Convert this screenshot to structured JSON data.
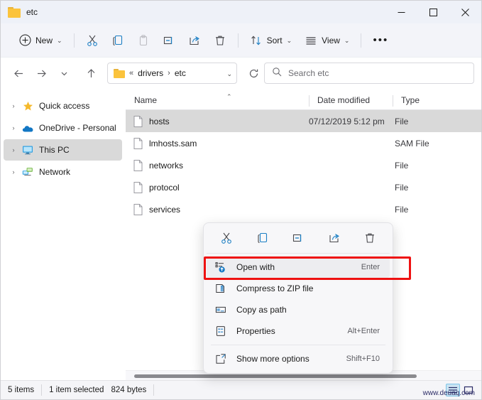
{
  "window": {
    "title": "etc",
    "folder_icon": "folder-icon",
    "controls": [
      {
        "name": "minimize",
        "glyph": "minimize-icon"
      },
      {
        "name": "maximize",
        "glyph": "maximize-icon"
      },
      {
        "name": "close",
        "glyph": "close-icon"
      }
    ]
  },
  "commandbar": {
    "new_label": "New",
    "sort_label": "Sort",
    "view_label": "View",
    "more_label": "•••",
    "items": [
      {
        "name": "new-button",
        "icon": "plus-circle-icon",
        "label": "New",
        "caret": "⌄"
      },
      {
        "name": "cut-button",
        "icon": "scissors-icon",
        "label": ""
      },
      {
        "name": "copy-button",
        "icon": "copy-icon",
        "label": ""
      },
      {
        "name": "paste-button",
        "icon": "clipboard-icon",
        "label": ""
      },
      {
        "name": "rename-button",
        "icon": "rename-icon",
        "label": ""
      },
      {
        "name": "share-button",
        "icon": "share-icon",
        "label": ""
      },
      {
        "name": "delete-button",
        "icon": "trash-icon",
        "label": ""
      },
      {
        "name": "sort-button",
        "icon": "sort-arrows-icon",
        "label": "Sort",
        "caret": "⌄"
      },
      {
        "name": "view-button",
        "icon": "hamburger-icon",
        "label": "View",
        "caret": "⌄"
      },
      {
        "name": "more-button",
        "icon": "ellipsis-icon",
        "label": ""
      }
    ]
  },
  "navbar": {
    "back": "back-arrow-icon",
    "forward": "forward-arrow-icon",
    "recent": "chevron-down-icon",
    "up": "up-arrow-icon",
    "breadcrumb": {
      "overflow": "«",
      "parts": [
        "drivers",
        "etc"
      ],
      "separator": "›",
      "dropdown": "⌄"
    },
    "refresh": "refresh-icon"
  },
  "search": {
    "icon": "search-icon",
    "placeholder": "Search etc"
  },
  "sidebar": {
    "items": [
      {
        "label": "Quick access",
        "icon": "star-icon",
        "selected": false
      },
      {
        "label": "OneDrive - Personal",
        "icon": "cloud-icon",
        "selected": false
      },
      {
        "label": "This PC",
        "icon": "monitor-icon",
        "selected": true
      },
      {
        "label": "Network",
        "icon": "network-icon",
        "selected": false
      }
    ],
    "expander": "›"
  },
  "filelist": {
    "columns": [
      {
        "key": "name",
        "label": "Name",
        "sorted": true,
        "sort_caret": "⌃"
      },
      {
        "key": "date",
        "label": "Date modified"
      },
      {
        "key": "type",
        "label": "Type"
      }
    ],
    "rows": [
      {
        "name": "hosts",
        "date": "07/12/2019 5:12 pm",
        "type": "File",
        "selected": true
      },
      {
        "name": "lmhosts.sam",
        "date": "",
        "type": "SAM File",
        "selected": false
      },
      {
        "name": "networks",
        "date": "",
        "type": "File",
        "selected": false
      },
      {
        "name": "protocol",
        "date": "",
        "type": "File",
        "selected": false
      },
      {
        "name": "services",
        "date": "",
        "type": "File",
        "selected": false
      }
    ]
  },
  "contextmenu": {
    "icon_row": [
      {
        "name": "cut",
        "icon": "scissors-icon"
      },
      {
        "name": "copy",
        "icon": "copy-icon"
      },
      {
        "name": "rename",
        "icon": "rename-icon"
      },
      {
        "name": "share",
        "icon": "share-icon"
      },
      {
        "name": "delete",
        "icon": "trash-icon"
      }
    ],
    "items": [
      {
        "label": "Open with",
        "accel": "Enter",
        "icon": "open-with-icon",
        "highlighted": true
      },
      {
        "label": "Compress to ZIP file",
        "accel": "",
        "icon": "zip-icon",
        "highlighted": false
      },
      {
        "label": "Copy as path",
        "accel": "",
        "icon": "copy-path-icon",
        "highlighted": false
      },
      {
        "label": "Properties",
        "accel": "Alt+Enter",
        "icon": "properties-icon",
        "highlighted": false
      },
      {
        "label": "Show more options",
        "accel": "Shift+F10",
        "icon": "more-options-icon",
        "highlighted": false
      }
    ]
  },
  "statusbar": {
    "item_count": "5 items",
    "selection": "1 item selected",
    "size": "824 bytes",
    "watermark": "www.deuaq.com",
    "view_buttons": [
      {
        "name": "details-view",
        "icon": "details-view-icon",
        "active": true
      },
      {
        "name": "large-icons-view",
        "icon": "large-icons-view-icon",
        "active": false
      }
    ]
  },
  "annotation": {
    "color": "#ee1111",
    "target": "Open with"
  }
}
